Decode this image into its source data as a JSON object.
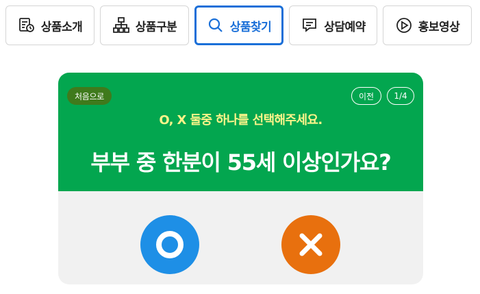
{
  "tabs": [
    {
      "label": "상품소개",
      "icon": "product-info-icon"
    },
    {
      "label": "상품구분",
      "icon": "org-chart-icon"
    },
    {
      "label": "상품찾기",
      "icon": "search-icon"
    },
    {
      "label": "상담예약",
      "icon": "chat-icon"
    },
    {
      "label": "홍보영상",
      "icon": "play-icon"
    }
  ],
  "active_tab": "상품찾기",
  "quiz": {
    "home_label": "처음으로",
    "prev_label": "이전",
    "progress": "1/4",
    "instruction": "O, X 둘중 하나를 선택해주세요.",
    "question": "부부 중 한분이 55세 이상인가요?",
    "answers": [
      {
        "value": "O",
        "icon": "circle-o-icon"
      },
      {
        "value": "X",
        "icon": "cross-x-icon"
      }
    ]
  },
  "colors": {
    "accent_blue": "#1a6fd8",
    "card_green": "#03a64f",
    "home_button": "#3f7a1c",
    "instruction_yellow": "#fff48a",
    "answer_o": "#1e8fe6",
    "answer_x": "#e8700e",
    "card_bottom": "#f1f1f1"
  }
}
